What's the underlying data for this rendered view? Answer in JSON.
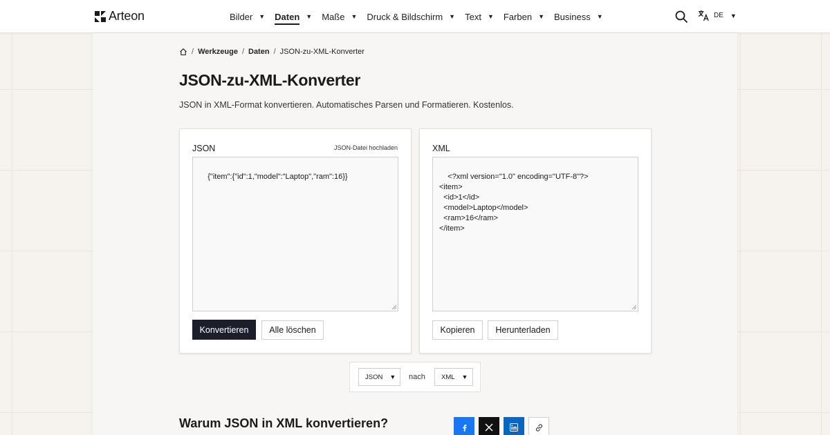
{
  "brand": {
    "name": "Arteon",
    "accent": "#1c1e2b"
  },
  "nav": {
    "items": [
      {
        "label": "Bilder",
        "active": false
      },
      {
        "label": "Daten",
        "active": true
      },
      {
        "label": "Maße",
        "active": false
      },
      {
        "label": "Druck & Bildschirm",
        "active": false
      },
      {
        "label": "Text",
        "active": false
      },
      {
        "label": "Farben",
        "active": false
      },
      {
        "label": "Business",
        "active": false
      }
    ],
    "language": "DE"
  },
  "breadcrumb": [
    "Werkzeuge",
    "Daten",
    "JSON-zu-XML-Konverter"
  ],
  "page": {
    "title": "JSON-zu-XML-Konverter",
    "description": "JSON in XML-Format konvertieren. Automatisches Parsen und Formatieren. Kostenlos."
  },
  "input_card": {
    "label": "JSON",
    "upload_link": "JSON-Datei hochladen",
    "value": "{\"item\":{\"id\":1,\"model\":\"Laptop\",\"ram\":16}}",
    "convert_button": "Konvertieren",
    "clear_button": "Alle löschen"
  },
  "output_card": {
    "label": "XML",
    "value": "<?xml version=\"1.0\" encoding=\"UTF-8\"?>\n<item>\n  <id>1</id>\n  <model>Laptop</model>\n  <ram>16</ram>\n</item>",
    "copy_button": "Kopieren",
    "download_button": "Herunterladen"
  },
  "format_bar": {
    "from": "JSON",
    "connector": "nach",
    "to": "XML"
  },
  "section": {
    "heading": "Warum JSON in XML konvertieren?"
  },
  "share": [
    {
      "icon": "facebook-icon",
      "color": "#1877f2"
    },
    {
      "icon": "x-icon",
      "color": "#111111"
    },
    {
      "icon": "linkedin-icon",
      "color": "#0a66c2"
    },
    {
      "icon": "link-icon",
      "color": "#ffffff"
    }
  ]
}
